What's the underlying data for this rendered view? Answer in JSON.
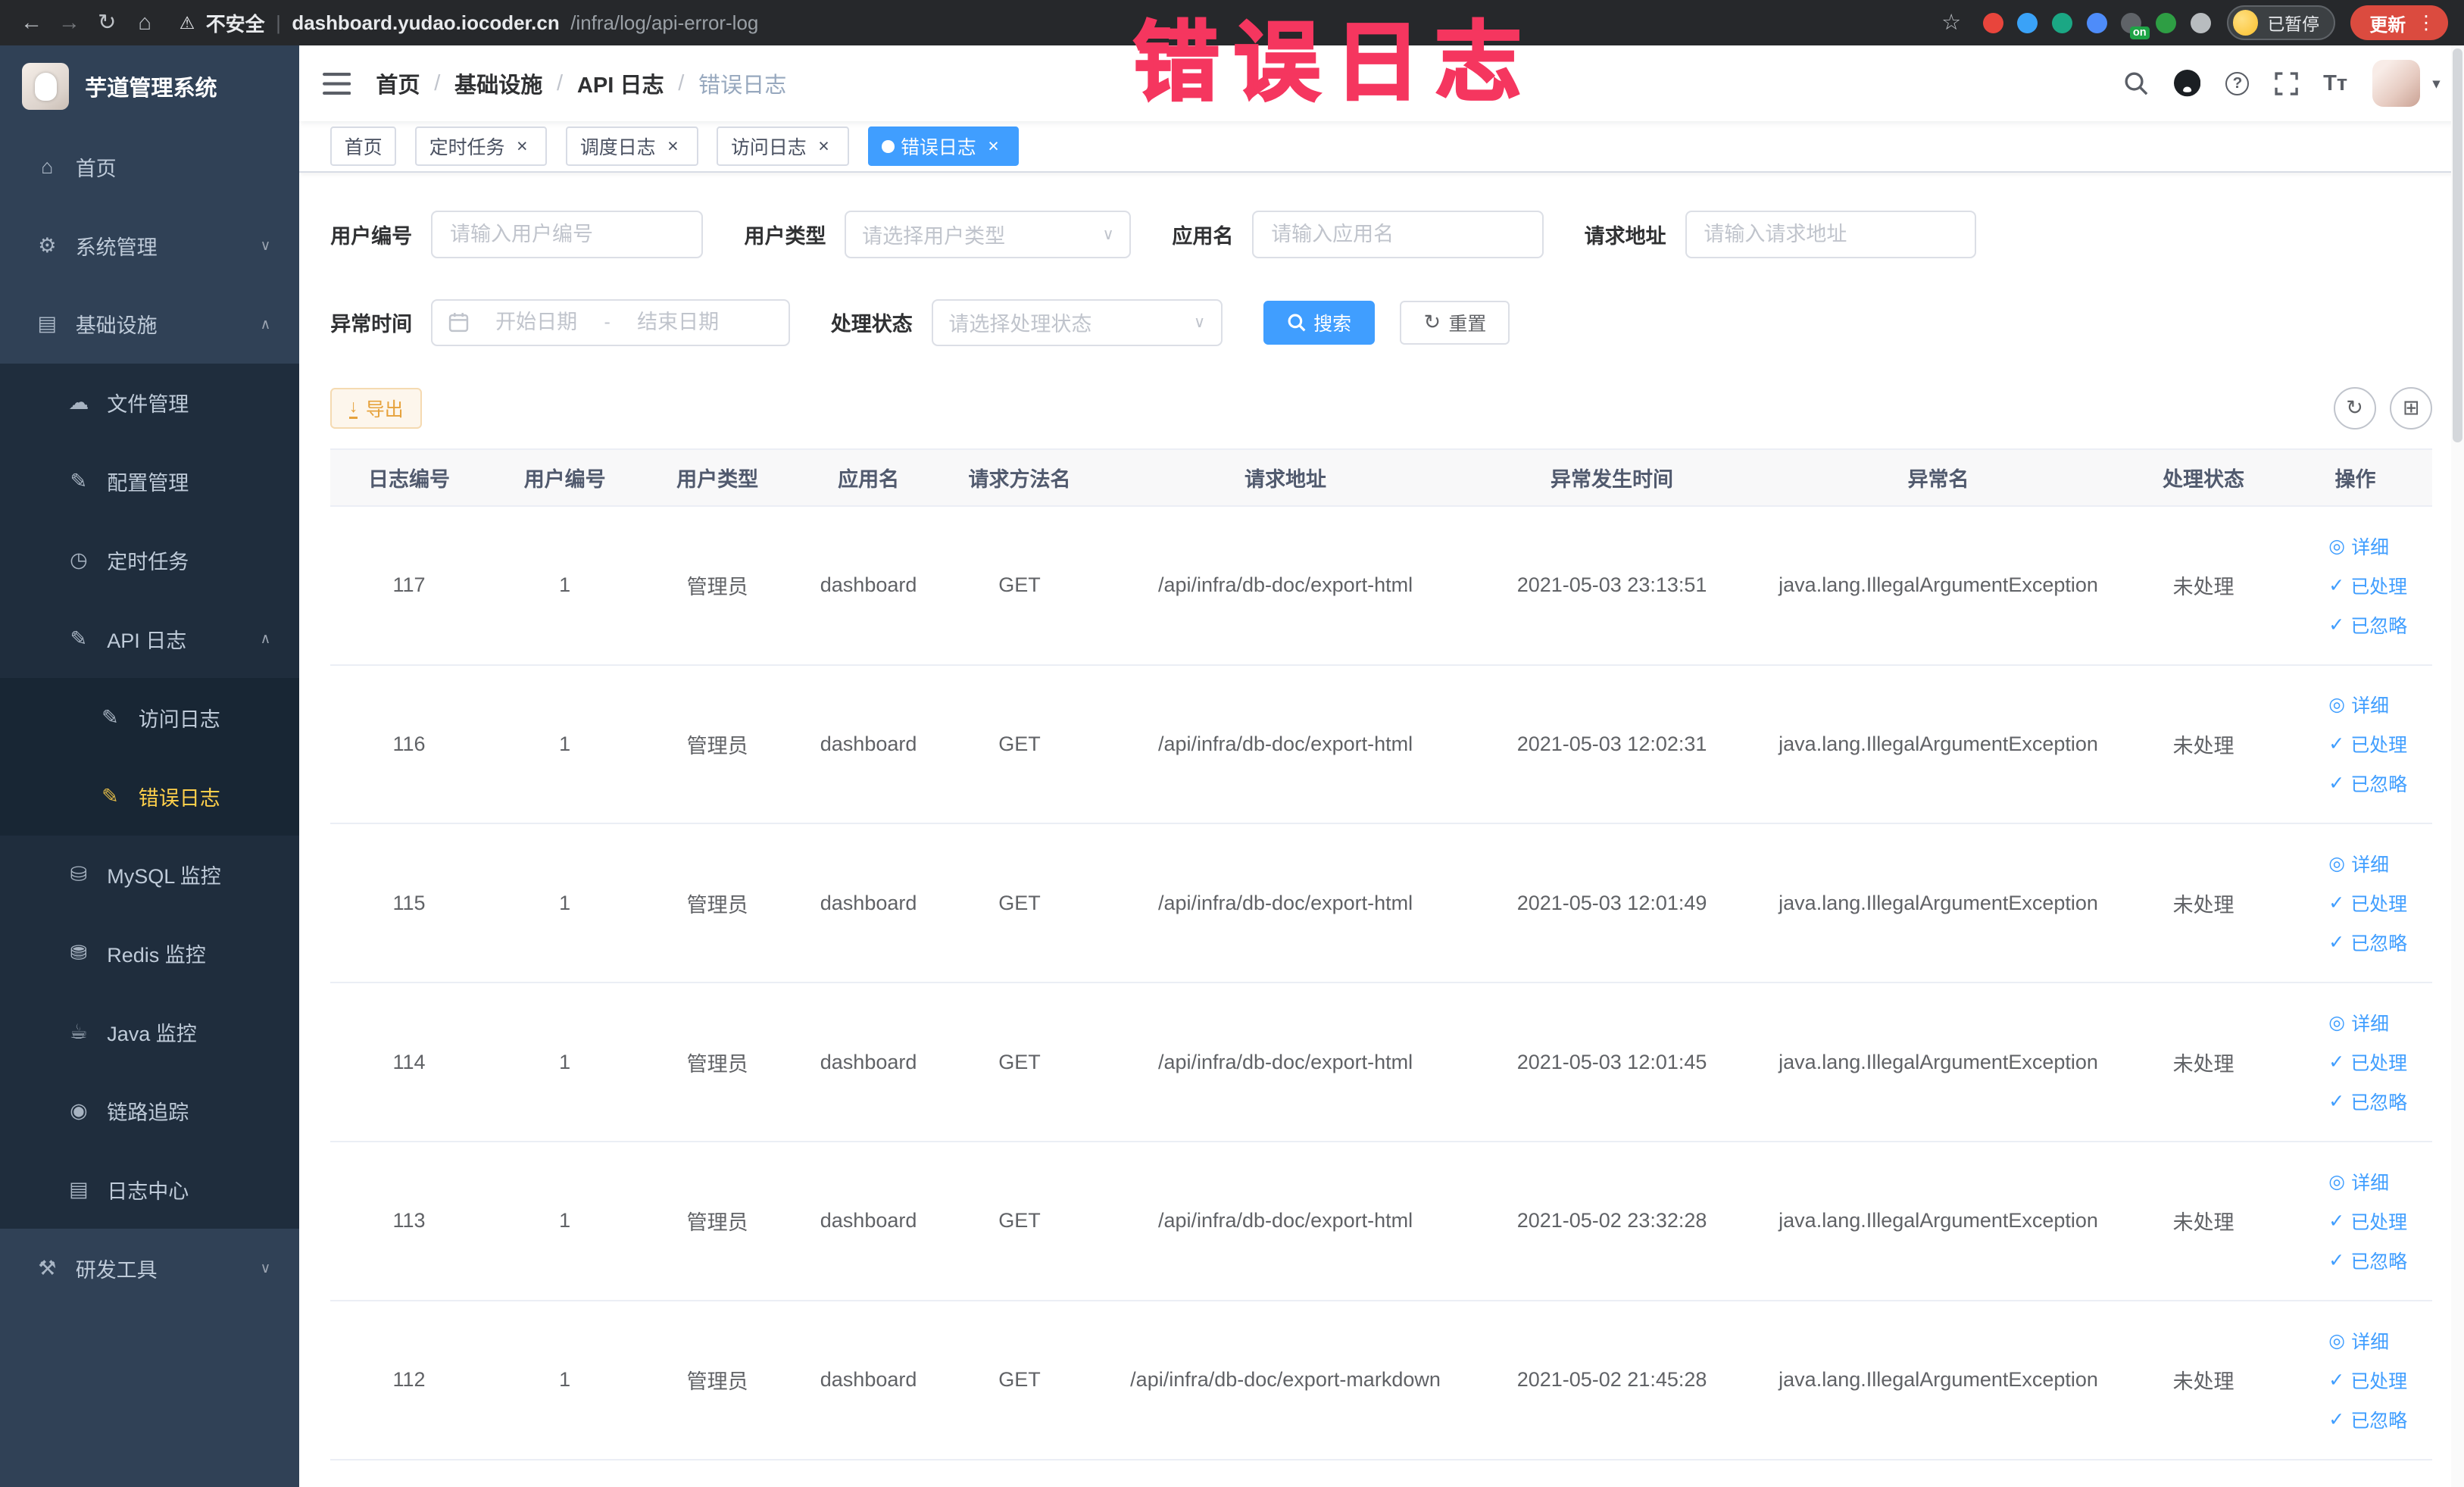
{
  "colors": {
    "primary": "#409eff",
    "menu_active_text": "#ffd04b",
    "sidebar_bg": "#304156",
    "watermark_red": "#f5365f",
    "warning": "#e6a23c",
    "update_button_red": "#db4b3f"
  },
  "icons": {
    "back": "←",
    "forward": "→",
    "reload": "↻",
    "home": "⌂",
    "warning": "⚠",
    "star": "☆",
    "kebab": "⋮",
    "help": "?",
    "font_size": "Tт",
    "caret_down": "▾",
    "select_chevron": "∨",
    "date_separator": "-",
    "reset_icon": "↻",
    "download_icon": "↓",
    "refresh_icon": "↻",
    "columns_icon": "⊞"
  },
  "browser": {
    "security_label": "不安全",
    "url_host": "dashboard.yudao.iocoder.cn",
    "url_path": "/infra/log/api-error-log",
    "paused_badge": "已暂停",
    "update_label": "更新",
    "extensions": [
      {
        "name": "red-circle",
        "color": "#e8453c"
      },
      {
        "name": "water-drop",
        "color": "#3aa2f7"
      },
      {
        "name": "teal-v",
        "color": "#1ba784"
      },
      {
        "name": "blue-grid",
        "color": "#4e8cf9"
      },
      {
        "name": "switch",
        "color": "#5f6368",
        "badge": "on"
      },
      {
        "name": "green-leaf",
        "color": "#2e9e44"
      },
      {
        "name": "puzzle",
        "color": "#b8bcbf"
      }
    ]
  },
  "watermark": "错误日志",
  "sidebar": {
    "logo_title": "芋道管理系统",
    "items": [
      {
        "key": "home",
        "label": "首页",
        "icon_name": "home-icon",
        "icon_glyph": "⌂",
        "level": 0
      },
      {
        "key": "system-management",
        "label": "系统管理",
        "icon_name": "gear-icon",
        "icon_glyph": "⚙",
        "level": 0,
        "chevron": "down"
      },
      {
        "key": "infrastructure",
        "label": "基础设施",
        "icon_name": "infrastructure-icon",
        "icon_glyph": "▤",
        "level": 0,
        "chevron": "up"
      },
      {
        "key": "file-management",
        "label": "文件管理",
        "icon_name": "file-cloud-icon",
        "icon_glyph": "☁",
        "level": 1
      },
      {
        "key": "config-management",
        "label": "配置管理",
        "icon_name": "edit-icon",
        "icon_glyph": "✎",
        "level": 1
      },
      {
        "key": "scheduled-tasks",
        "label": "定时任务",
        "icon_name": "timer-icon",
        "icon_glyph": "◷",
        "level": 1
      },
      {
        "key": "api-logs",
        "label": "API 日志",
        "icon_name": "api-log-icon",
        "icon_glyph": "✎",
        "level": 1,
        "chevron": "up"
      },
      {
        "key": "access-logs",
        "label": "访问日志",
        "icon_name": "access-log-icon",
        "icon_glyph": "✎",
        "level": 2
      },
      {
        "key": "error-logs",
        "label": "错误日志",
        "icon_name": "error-log-icon",
        "icon_glyph": "✎",
        "level": 2,
        "active": true
      },
      {
        "key": "mysql-monitor",
        "label": "MySQL 监控",
        "icon_name": "mysql-database-icon",
        "icon_glyph": "⛁",
        "level": 1
      },
      {
        "key": "redis-monitor",
        "label": "Redis 监控",
        "icon_name": "redis-database-icon",
        "icon_glyph": "⛃",
        "level": 1
      },
      {
        "key": "java-monitor",
        "label": "Java 监控",
        "icon_name": "java-coffee-icon",
        "icon_glyph": "☕",
        "level": 1
      },
      {
        "key": "trace",
        "label": "链路追踪",
        "icon_name": "trace-eye-icon",
        "icon_glyph": "◉",
        "level": 1
      },
      {
        "key": "log-center",
        "label": "日志中心",
        "icon_name": "log-center-icon",
        "icon_glyph": "▤",
        "level": 1
      },
      {
        "key": "dev-tools",
        "label": "研发工具",
        "icon_name": "devtools-icon",
        "icon_glyph": "⚒",
        "level": 0,
        "chevron": "down"
      }
    ]
  },
  "navbar": {
    "breadcrumb": [
      {
        "label": "首页"
      },
      {
        "label": "基础设施"
      },
      {
        "label": "API 日志"
      },
      {
        "label": "错误日志"
      }
    ]
  },
  "tags": [
    {
      "label": "首页",
      "closable": false,
      "active": false
    },
    {
      "label": "定时任务",
      "closable": true,
      "active": false
    },
    {
      "label": "调度日志",
      "closable": true,
      "active": false
    },
    {
      "label": "访问日志",
      "closable": true,
      "active": false
    },
    {
      "label": "错误日志",
      "closable": true,
      "active": true
    }
  ],
  "filters": {
    "user_id_label": "用户编号",
    "user_id_placeholder": "请输入用户编号",
    "user_type_label": "用户类型",
    "user_type_placeholder": "请选择用户类型",
    "app_name_label": "应用名",
    "app_name_placeholder": "请输入应用名",
    "request_url_label": "请求地址",
    "request_url_placeholder": "请输入请求地址",
    "exception_time_label": "异常时间",
    "date_start_placeholder": "开始日期",
    "date_end_placeholder": "结束日期",
    "process_status_label": "处理状态",
    "process_status_placeholder": "请选择处理状态",
    "search_label": "搜索",
    "reset_label": "重置"
  },
  "toolbar": {
    "export_label": "导出"
  },
  "table": {
    "columns": [
      "日志编号",
      "用户编号",
      "用户类型",
      "应用名",
      "请求方法名",
      "请求地址",
      "异常发生时间",
      "异常名",
      "处理状态",
      "操作"
    ],
    "rows": [
      {
        "id": "117",
        "user_id": "1",
        "user_type": "管理员",
        "app": "dashboard",
        "method": "GET",
        "url": "/api/infra/db-doc/export-html",
        "time": "2021-05-03 23:13:51",
        "exception": "java.lang.IllegalArgumentException",
        "status": "未处理"
      },
      {
        "id": "116",
        "user_id": "1",
        "user_type": "管理员",
        "app": "dashboard",
        "method": "GET",
        "url": "/api/infra/db-doc/export-html",
        "time": "2021-05-03 12:02:31",
        "exception": "java.lang.IllegalArgumentException",
        "status": "未处理"
      },
      {
        "id": "115",
        "user_id": "1",
        "user_type": "管理员",
        "app": "dashboard",
        "method": "GET",
        "url": "/api/infra/db-doc/export-html",
        "time": "2021-05-03 12:01:49",
        "exception": "java.lang.IllegalArgumentException",
        "status": "未处理"
      },
      {
        "id": "114",
        "user_id": "1",
        "user_type": "管理员",
        "app": "dashboard",
        "method": "GET",
        "url": "/api/infra/db-doc/export-html",
        "time": "2021-05-03 12:01:45",
        "exception": "java.lang.IllegalArgumentException",
        "status": "未处理"
      },
      {
        "id": "113",
        "user_id": "1",
        "user_type": "管理员",
        "app": "dashboard",
        "method": "GET",
        "url": "/api/infra/db-doc/export-html",
        "time": "2021-05-02 23:32:28",
        "exception": "java.lang.IllegalArgumentException",
        "status": "未处理"
      },
      {
        "id": "112",
        "user_id": "1",
        "user_type": "管理员",
        "app": "dashboard",
        "method": "GET",
        "url": "/api/infra/db-doc/export-markdown",
        "time": "2021-05-02 21:45:28",
        "exception": "java.lang.IllegalArgumentException",
        "status": "未处理"
      }
    ],
    "actions": [
      {
        "label": "详细",
        "icon": "◎",
        "icon_name": "eye-icon"
      },
      {
        "label": "已处理",
        "icon": "✓",
        "icon_name": "check-icon"
      },
      {
        "label": "已忽略",
        "icon": "✓",
        "icon_name": "check-icon"
      }
    ]
  }
}
